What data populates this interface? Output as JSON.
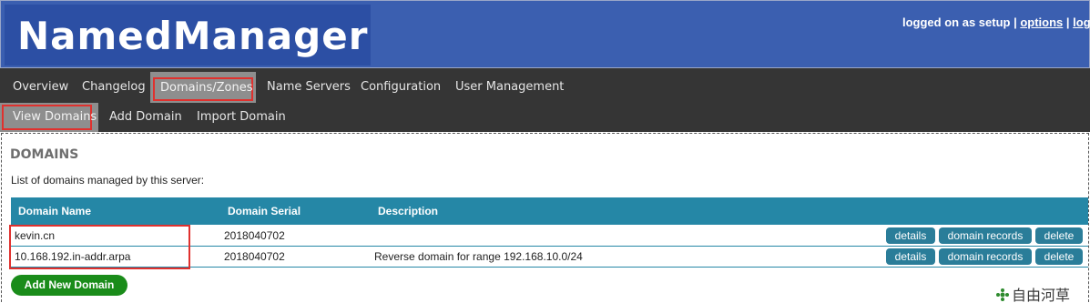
{
  "app": {
    "title": "NamedManager"
  },
  "userbar": {
    "prefix": "logged on as setup",
    "sep1": " | ",
    "options_label": "options",
    "sep2": " | ",
    "logout_label": "logout"
  },
  "menu": {
    "items": [
      {
        "label": "Overview"
      },
      {
        "label": "Changelog"
      },
      {
        "label": "Domains/Zones",
        "active": true
      },
      {
        "label": "Name Servers"
      },
      {
        "label": "Configuration"
      },
      {
        "label": "User Management"
      }
    ],
    "subitems": [
      {
        "label": "View Domains",
        "active": true
      },
      {
        "label": "Add Domain"
      },
      {
        "label": "Import Domain"
      }
    ]
  },
  "page": {
    "heading": "DOMAINS",
    "intro": "List of domains managed by this server:"
  },
  "table": {
    "columns": [
      "Domain Name",
      "Domain Serial",
      "Description"
    ],
    "rows": [
      {
        "name": "kevin.cn",
        "serial": "2018040702",
        "description": ""
      },
      {
        "name": "10.168.192.in-addr.arpa",
        "serial": "2018040702",
        "description": "Reverse domain for range 192.168.10.0/24"
      }
    ],
    "actions": [
      "details",
      "domain records",
      "delete"
    ]
  },
  "add_button": {
    "label": "Add New Domain"
  },
  "watermark": {
    "text": "自由河草"
  },
  "colors": {
    "header_bg": "#3b5fb0",
    "menu_bg": "#353535",
    "table_head": "#2587a6",
    "action_button": "#2a7d99",
    "add_button": "#1a8c1a",
    "highlight": "#e0312e"
  }
}
